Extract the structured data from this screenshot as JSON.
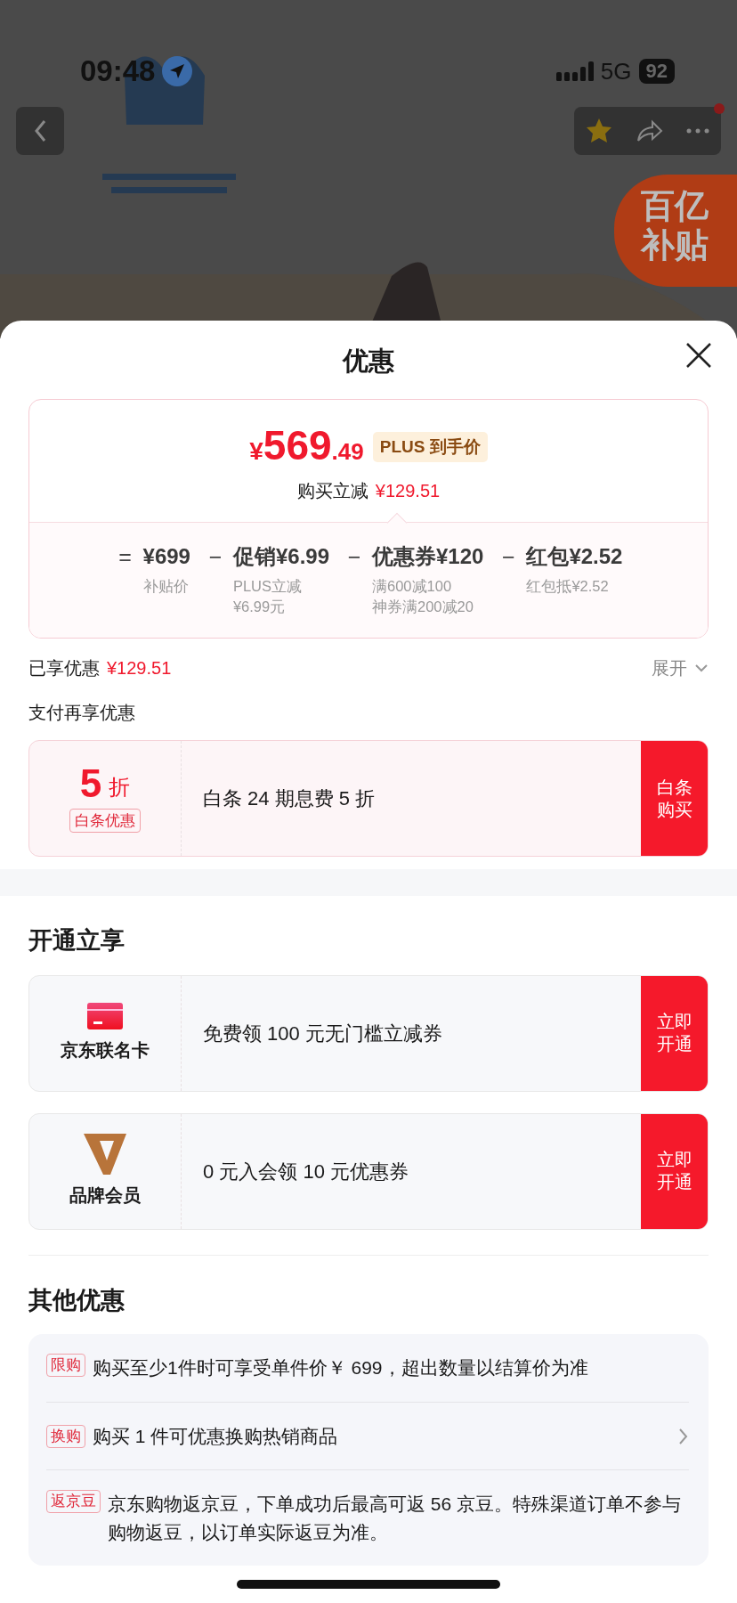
{
  "status_bar": {
    "time": "09:48",
    "network": "5G",
    "battery": "92"
  },
  "subsidy_badge": {
    "lines": [
      "百亿",
      "补贴"
    ]
  },
  "sheet": {
    "title": "优惠"
  },
  "price": {
    "symbol": "¥",
    "integer": "569",
    "decimal": ".49",
    "tag": "PLUS 到手价",
    "instant_label": "购买立减",
    "instant_amount": "¥129.51"
  },
  "breakdown": [
    {
      "operator": "=",
      "main": "¥699",
      "notes": [
        "补贴价"
      ]
    },
    {
      "operator": "−",
      "main": "促销¥6.99",
      "notes": [
        "PLUS立减",
        "¥6.99元"
      ]
    },
    {
      "operator": "−",
      "main": "优惠券¥120",
      "notes": [
        "满600减100",
        "神券满200减20"
      ]
    },
    {
      "operator": "−",
      "main": "红包¥2.52",
      "notes": [
        "红包抵¥2.52"
      ]
    }
  ],
  "enjoyed": {
    "label": "已享优惠",
    "amount": "¥129.51",
    "toggle": "展开",
    "expanded": false
  },
  "payment": {
    "title": "支付再享优惠",
    "offers": [
      {
        "value": "5",
        "unit": "折",
        "tag": "白条优惠",
        "text": "白条 24 期息费 5 折",
        "button": "白条购买"
      }
    ]
  },
  "open_section": {
    "title": "开通立享",
    "items": [
      {
        "kind": "card",
        "name": "京东联名卡",
        "text": "免费领 100 元无门槛立减券",
        "button": "立即开通"
      },
      {
        "kind": "brand",
        "name": "品牌会员",
        "text": "0 元入会领 10 元优惠券",
        "button": "立即开通"
      }
    ]
  },
  "other": {
    "title": "其他优惠",
    "items": [
      {
        "tag": "限购",
        "text": "购买至少1件时可享受单件价￥ 699，超出数量以结算价为准",
        "has_arrow": false
      },
      {
        "tag": "换购",
        "text": "购买 1 件可优惠换购热销商品",
        "has_arrow": true
      },
      {
        "tag": "返京豆",
        "text": "京东购物返京豆，下单成功后最高可返 56 京豆。特殊渠道订单不参与购物返豆，以订单实际返豆为准。",
        "has_arrow": false
      }
    ]
  }
}
